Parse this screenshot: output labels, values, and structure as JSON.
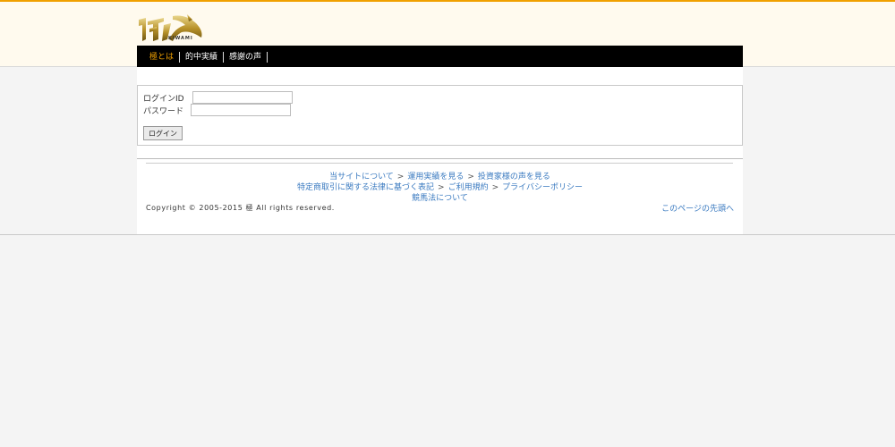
{
  "logo": {
    "text": "KIWAMI"
  },
  "nav": {
    "items": [
      {
        "label": "極とは"
      },
      {
        "label": "的中実績"
      },
      {
        "label": "感謝の声"
      }
    ]
  },
  "login": {
    "id_label": "ログインID",
    "id_value": "",
    "password_label": "パスワード",
    "password_value": "",
    "button_label": "ログイン"
  },
  "footer": {
    "row1": [
      "当サイトについて",
      "運用実績を見る",
      "投資家様の声を見る"
    ],
    "row2": [
      "特定商取引に関する法律に基づく表記",
      "ご利用規約",
      "プライバシーポリシー"
    ],
    "row3": [
      "競馬法について"
    ],
    "separator": ">",
    "copyright": "Copyright © 2005-2015 極 All rights reserved.",
    "pagetop": "このページの先頭へ"
  },
  "colors": {
    "accent": "#f0a000",
    "link": "#3a7ac0",
    "nav_bg": "#000000",
    "header_bg": "#fffaee"
  }
}
